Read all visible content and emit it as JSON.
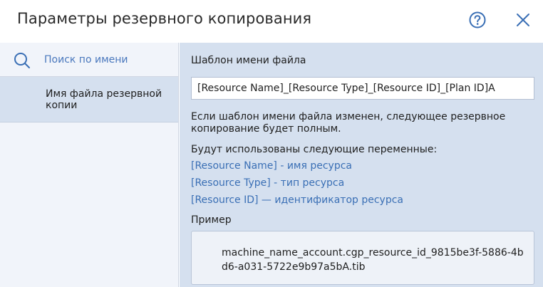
{
  "dialog": {
    "title": "Параметры резервного копирования",
    "help_icon": "help-circle-icon",
    "close_icon": "close-icon"
  },
  "sidebar": {
    "search": {
      "icon": "search-icon",
      "placeholder": "Поиск по имени"
    },
    "items": [
      {
        "label": "Имя файла резервной копии",
        "selected": true
      }
    ]
  },
  "main": {
    "template_label": "Шаблон имени файла",
    "template_value": "[Resource Name]_[Resource Type]_[Resource ID]_[Plan ID]A",
    "notice": "Если шаблон имени файла изменен, следующее резервное копирование будет полным.",
    "variables_label": "Будут использованы следующие переменные:",
    "variables": [
      "[Resource Name] - имя ресурса",
      "[Resource Type] - тип ресурса",
      "[Resource ID] — идентификатор ресурса"
    ],
    "example_label": "Пример",
    "example_value": "machine_name_account.cgp_resource_id_9815be3f-5886-4bd6-a031-5722e9b97a5bA.tib"
  },
  "colors": {
    "accent": "#3a6fb5",
    "panel_bg": "#d5e0ef",
    "sidebar_bg": "#f1f4fa"
  }
}
